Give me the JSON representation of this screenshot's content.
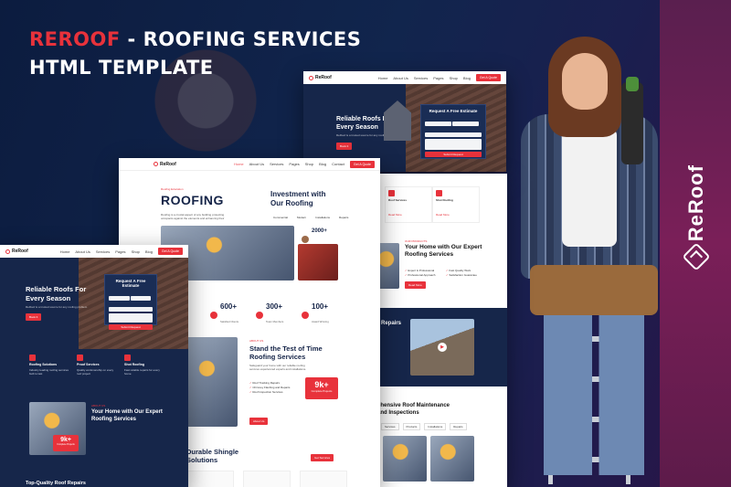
{
  "hero": {
    "brand": "REROOF",
    "title_rest": " - ROOFING SERVICES",
    "subtitle": "HTML TEMPLATE"
  },
  "side_logo": {
    "text": "ReRoof",
    "icon": "house-diamond-icon"
  },
  "colors": {
    "accent": "#e8323b",
    "navy": "#16264a",
    "panel": "#7a1f58"
  },
  "nav": {
    "logo": "ReRoof",
    "items": [
      "Home",
      "About Us",
      "Services",
      "Pages",
      "Shop",
      "Blog",
      "Contact"
    ],
    "cta": "Get A Quote"
  },
  "top_screen": {
    "heading_line1": "Reliable Roofs For",
    "heading_line2": "Every Season",
    "paragraph": "ReRoof is a trusted source for any roofing problem",
    "button": "Book It",
    "form_title": "Request A Free Estimate",
    "form_submit": "Submit Request"
  },
  "main_screen": {
    "breadcrumb": "Roofing Education",
    "title": "ROOFING",
    "intro": "Roofing is a crucial aspect of any building protecting occupants against the elements and enhancing their",
    "invest_line1": "Investment with",
    "invest_line2": "Our Roofing",
    "tabs": [
      "Commercial",
      "Modern",
      "Installations",
      "Repairs"
    ],
    "clients_count": "2000+",
    "clients_label": "Happy Clients",
    "stats": [
      {
        "value": "600+",
        "label": "Satisfied Clients"
      },
      {
        "value": "300+",
        "label": "Team Members"
      },
      {
        "value": "100+",
        "label": "Award Winning"
      }
    ],
    "about_tag": "ABOUT US",
    "about_title_line1": "Stand the Test of Time",
    "about_title_line2": "Roofing Services",
    "about_text": "Safeguard your home with our reliable roofing services experienced experts and installations.",
    "checks": [
      "Roof Tracking Repairs",
      "Chimney Flashing and Repairs",
      "Roof Inspection Services"
    ],
    "badge_value": "9k+",
    "badge_label": "Complete Projects",
    "about_btn": "About Us",
    "shingle_line1": "Durable Shingle",
    "shingle_line2": "Solutions",
    "shingle_btn": "Get Services"
  },
  "right_screen": {
    "cards": [
      {
        "title": "Roof Services",
        "link": "Read More"
      },
      {
        "title": "Shot Roofing",
        "link": "Read More"
      }
    ],
    "home_tag": "OUR PRODUCTS",
    "home_line1": "Your Home with Our Expert",
    "home_line2": "Roofing Services",
    "features": [
      "Expert & Professional",
      "Fast Quality Work",
      "Professional Approach",
      "Satisfaction Guarantee"
    ],
    "home_btn": "Read More",
    "repairs": "Repairs",
    "comp_line1": "ehensive Roof Maintenance",
    "comp_line2": "and Inspections",
    "tabs": [
      "Services",
      "Products",
      "Installations",
      "Repairs"
    ]
  },
  "left_screen": {
    "heading_line1": "Reliable Roofs For",
    "heading_line2": "Every Season",
    "paragraph": "ReRoof is a trusted source for any roofing problem",
    "button": "Book It",
    "form_title": "Request A Free Estimate",
    "form_submit": "Submit Request",
    "services": [
      {
        "title": "Roofing Solutions",
        "text": "Industry leading roofing services built to last"
      },
      {
        "title": "Proof Services",
        "text": "Quality workmanship on every roof project"
      },
      {
        "title": "Shot Roofing",
        "text": "Fast reliable repairs for every home"
      }
    ],
    "home_tag": "ABOUT US",
    "home_line1": "Your Home with Our Expert",
    "home_line2": "Roofing Services",
    "badge_value": "9k+",
    "badge_label": "Complete Projects",
    "bottom": "Top-Quality Roof Repairs"
  }
}
